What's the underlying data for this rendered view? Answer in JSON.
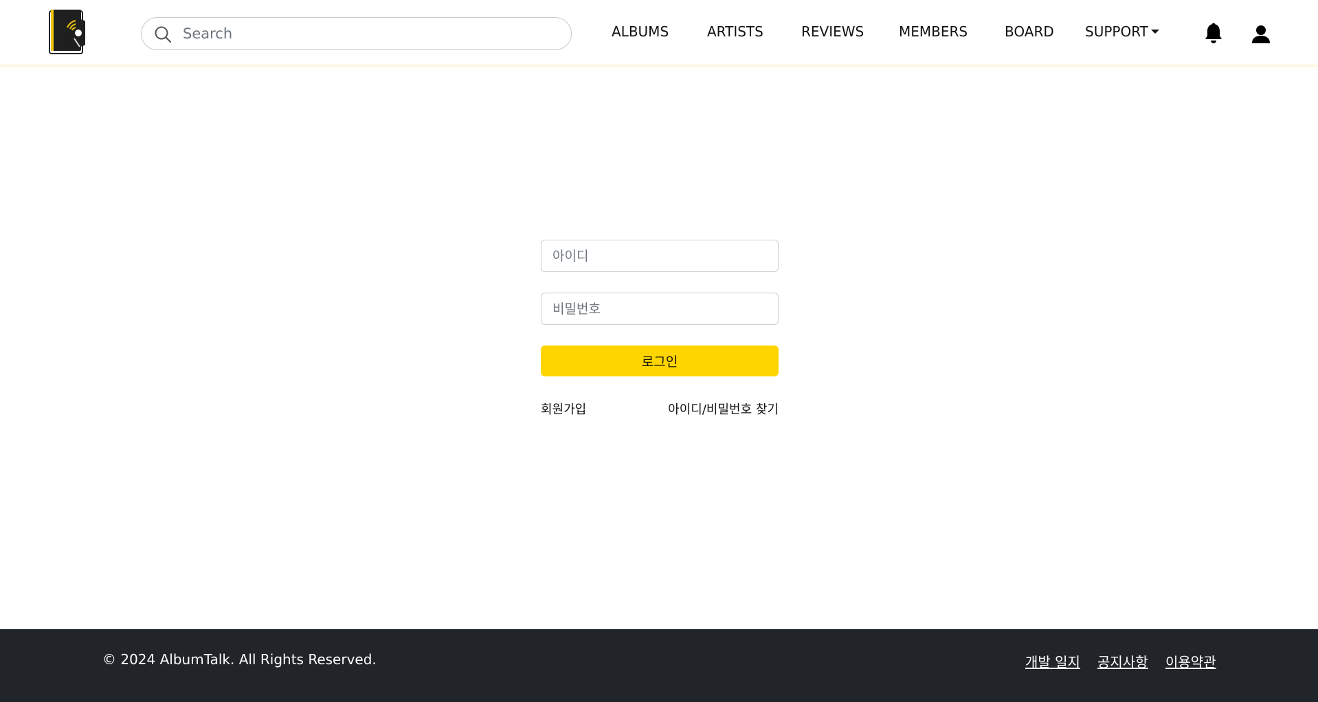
{
  "header": {
    "logo_icon": "vinyl-record-book-icon",
    "search": {
      "placeholder": "Search",
      "value": "",
      "icon": "search-icon"
    },
    "nav": {
      "albums": "ALBUMS",
      "artists": "ARTISTS",
      "reviews": "REVIEWS",
      "members": "MEMBERS",
      "board": "BOARD",
      "support": "SUPPORT"
    },
    "icons": [
      "bell-icon",
      "user-icon"
    ]
  },
  "login": {
    "id_placeholder": "아이디",
    "password_placeholder": "비밀번호",
    "login_button": "로그인",
    "signup_link": "회원가입",
    "find_link": "아이디/비밀번호 찾기"
  },
  "footer": {
    "copyright": "© 2024 AlbumTalk. All Rights Reserved.",
    "links": {
      "devlog": "개발 일지",
      "notice": "공지사항",
      "terms": "이용약관"
    }
  },
  "colors": {
    "accent": "#FFD500",
    "footer_bg": "#212529"
  }
}
